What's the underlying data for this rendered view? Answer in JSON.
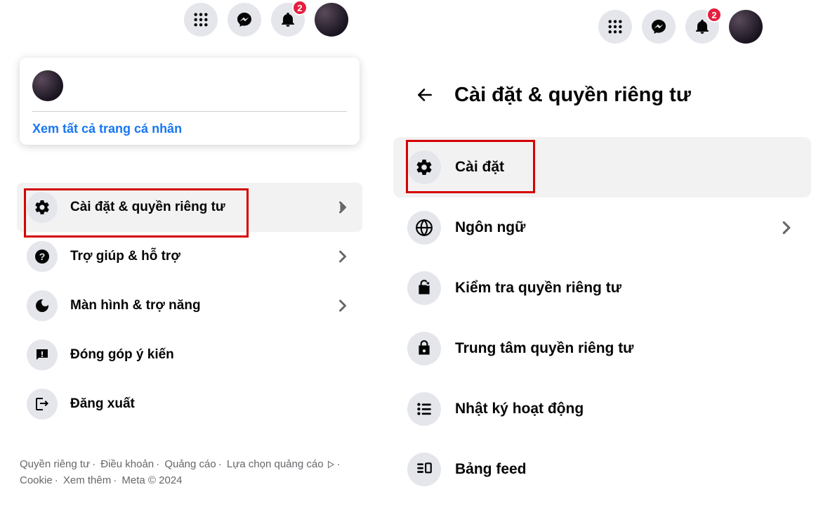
{
  "topnav": {
    "badge": "2"
  },
  "left": {
    "see_all": "Xem tất cả trang cá nhân",
    "items": [
      {
        "label": "Cài đặt & quyền riêng tư",
        "chevron": true
      },
      {
        "label": "Trợ giúp & hỗ trợ",
        "chevron": true
      },
      {
        "label": "Màn hình & trợ năng",
        "chevron": true
      },
      {
        "label": "Đóng góp ý kiến",
        "chevron": false
      },
      {
        "label": "Đăng xuất",
        "chevron": false
      }
    ],
    "footer": {
      "privacy": "Quyền riêng tư",
      "terms": "Điều khoản",
      "ads": "Quảng cáo",
      "adchoices": "Lựa chọn quảng cáo",
      "cookie": "Cookie",
      "more": "Xem thêm",
      "meta": "Meta © 2024"
    }
  },
  "right": {
    "title": "Cài đặt & quyền riêng tư",
    "items": [
      {
        "label": "Cài đặt",
        "chevron": false
      },
      {
        "label": "Ngôn ngữ",
        "chevron": true
      },
      {
        "label": "Kiểm tra quyền riêng tư",
        "chevron": false
      },
      {
        "label": "Trung tâm quyền riêng tư",
        "chevron": false
      },
      {
        "label": "Nhật ký hoạt động",
        "chevron": false
      },
      {
        "label": "Bảng feed",
        "chevron": false
      }
    ]
  }
}
